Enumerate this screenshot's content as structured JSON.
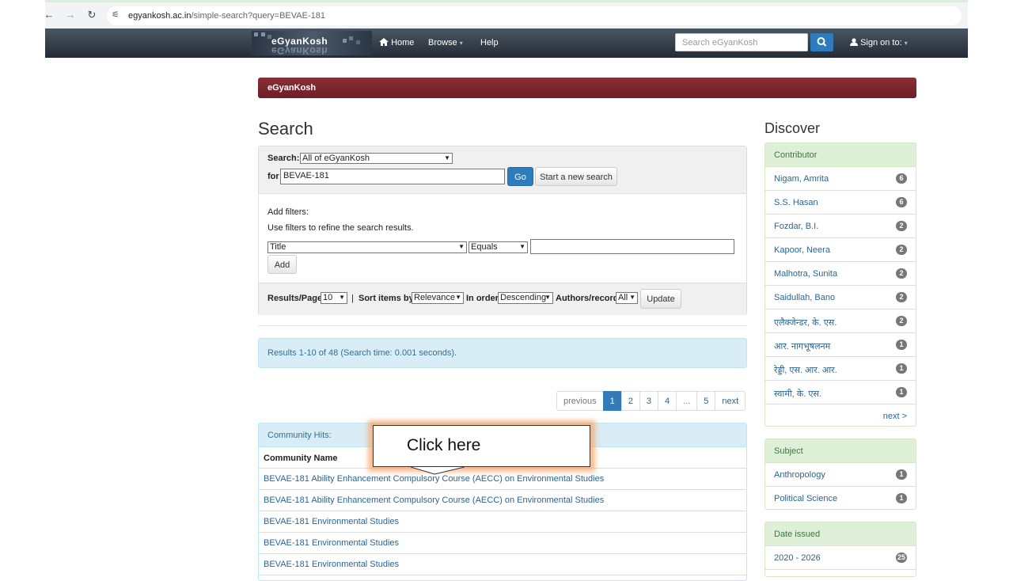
{
  "browser": {
    "url_domain": "egyankosh.ac.in",
    "url_path": "/simple-search?query=BEVAE-181"
  },
  "navbar": {
    "logo_text": "eGyanKosh",
    "home_label": "Home",
    "browse_label": "Browse",
    "help_label": "Help",
    "search_placeholder": "Search eGyanKosh",
    "signin_label": "Sign on to:"
  },
  "banner": {
    "text": "eGyanKosh"
  },
  "page": {
    "title": "Search"
  },
  "search_form": {
    "scope_label": "Search:",
    "scope_value": "All of eGyanKosh",
    "for_label": "for",
    "query_value": "BEVAE-181",
    "go_label": "Go",
    "new_search_label": "Start a new search",
    "add_filters_label": "Add filters:",
    "filters_hint": "Use filters to refine the search results.",
    "filter_field_value": "Title",
    "filter_op_value": "Equals",
    "add_label": "Add",
    "results_per_page_label": "Results/Page",
    "results_per_page_value": "10",
    "separator": "|",
    "sort_label": "Sort items by",
    "sort_value": "Relevance",
    "order_label": "In order",
    "order_value": "Descending",
    "authors_label": "Authors/record",
    "authors_value": "All",
    "update_label": "Update"
  },
  "results_summary": "Results 1-10 of 48 (Search time: 0.001 seconds).",
  "pagination": {
    "previous": "previous",
    "pages": [
      "1",
      "2",
      "3",
      "4",
      "...",
      "5"
    ],
    "current": "1",
    "next": "next"
  },
  "community_hits": {
    "heading": "Community Hits:",
    "column": "Community Name",
    "rows": [
      "BEVAE-181 Ability Enhancement Compulsory Course (AECC) on Environmental Studies",
      "BEVAE-181 Ability Enhancement Compulsory Course (AECC) on Environmental Studies",
      "BEVAE-181 Environmental Studies",
      "BEVAE-181 Environmental Studies",
      "BEVAE-181 Environmental Studies"
    ]
  },
  "callout": {
    "text": "Click here"
  },
  "discover": {
    "title": "Discover",
    "contributor": {
      "heading": "Contributor",
      "items": [
        {
          "name": "Nigam, Amrita",
          "count": "6"
        },
        {
          "name": "S.S. Hasan",
          "count": "6"
        },
        {
          "name": "Fozdar, B.I.",
          "count": "2"
        },
        {
          "name": "Kapoor, Neera",
          "count": "2"
        },
        {
          "name": "Malhotra, Sunita",
          "count": "2"
        },
        {
          "name": "Saidullah, Bano",
          "count": "2"
        },
        {
          "name": "एलैक्जेन्डर, के. एस.",
          "count": "2"
        },
        {
          "name": "आर. नागभूषलनम",
          "count": "1"
        },
        {
          "name": "रेड्डी, एस. आर. आर.",
          "count": "1"
        },
        {
          "name": "स्वामी, के. एस.",
          "count": "1"
        }
      ],
      "more": "next >"
    },
    "subject": {
      "heading": "Subject",
      "items": [
        {
          "name": "Anthropology",
          "count": "1"
        },
        {
          "name": "Political Science",
          "count": "1"
        }
      ]
    },
    "date_issued": {
      "heading": "Date issued",
      "items": [
        {
          "name": "2020 - 2026",
          "count": "25"
        }
      ]
    }
  },
  "colors": {
    "banner": "#7a242c",
    "link": "#2a6496",
    "primary": "#337ab7",
    "info_bg": "#d9edf7",
    "success_bg": "#dff0d8",
    "callout_glow": "#f6a66e"
  }
}
